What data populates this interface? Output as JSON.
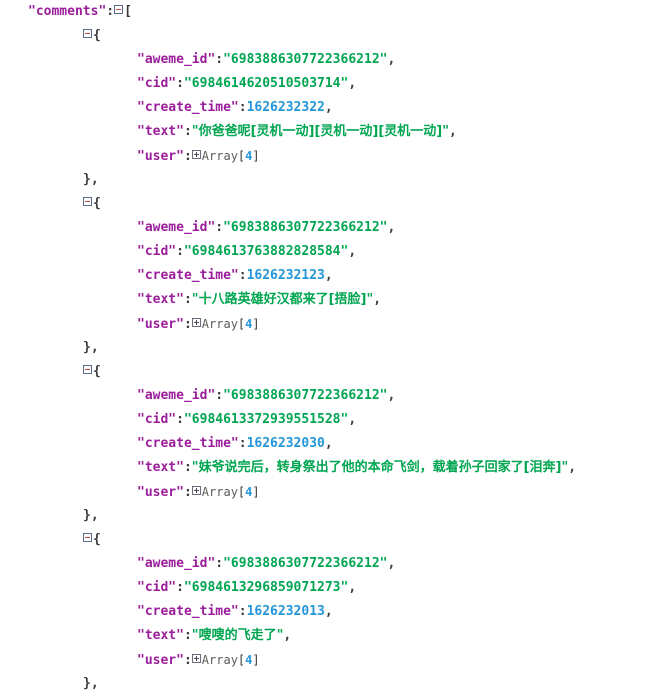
{
  "viewer": {
    "root_key": "\"comments\"",
    "root_colon": ":",
    "root_open_bracket": "[",
    "toggle_collapse_icon": "minus-box-icon",
    "toggle_expand_icon": "plus-box-icon",
    "open_brace": "{",
    "close_brace_comma": "},",
    "colon": ":",
    "comma": ",",
    "array_label": "Array",
    "array_open": "[",
    "array_close": "]",
    "colors": {
      "key": "#9b1d9b",
      "string": "#00a550",
      "number": "#2296d8",
      "punctuation": "#3a3a3a",
      "array_type": "#5a5a5a",
      "background": "#ffffff"
    }
  },
  "fields": {
    "aweme_id": "\"aweme_id\"",
    "cid": "\"cid\"",
    "create_time": "\"create_time\"",
    "text": "\"text\"",
    "user": "\"user\""
  },
  "comments": [
    {
      "aweme_id": "\"6983886307722366212\"",
      "cid": "\"6984614620510503714\"",
      "create_time": "1626232322",
      "text": "\"你爸爸呢[灵机一动][灵机一动][灵机一动]\"",
      "user_count": "4"
    },
    {
      "aweme_id": "\"6983886307722366212\"",
      "cid": "\"6984613763882828584\"",
      "create_time": "1626232123",
      "text": "\"十八路英雄好汉都来了[捂脸]\"",
      "user_count": "4"
    },
    {
      "aweme_id": "\"6983886307722366212\"",
      "cid": "\"6984613372939551528\"",
      "create_time": "1626232030",
      "text": "\"妹爷说完后，转身祭出了他的本命飞剑，载着孙子回家了[泪奔]\"",
      "user_count": "4"
    },
    {
      "aweme_id": "\"6983886307722366212\"",
      "cid": "\"6984613296859071273\"",
      "create_time": "1626232013",
      "text": "\"嗖嗖的飞走了\"",
      "user_count": "4"
    }
  ]
}
